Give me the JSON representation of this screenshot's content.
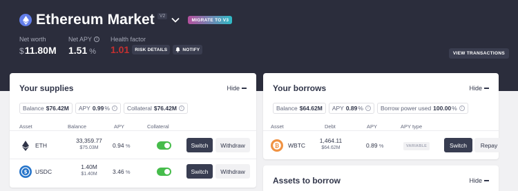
{
  "header": {
    "market_title": "Ethereum Market",
    "version_tag": "V2",
    "migrate_label": "MIGRATE TO V3",
    "net_worth_label": "Net worth",
    "net_worth_symbol": "$",
    "net_worth_value": "11.80M",
    "net_apy_label": "Net APY",
    "net_apy_value": "1.51",
    "net_apy_unit": "%",
    "health_factor_label": "Health factor",
    "health_factor_value": "1.01",
    "risk_details_label": "RISK DETAILS",
    "notify_label": "NOTIFY",
    "view_transactions_label": "VIEW TRANSACTIONS"
  },
  "supplies": {
    "title": "Your supplies",
    "hide_label": "Hide",
    "balance_label": "Balance",
    "balance_value": "$76.42M",
    "apy_label": "APY",
    "apy_value": "0.99",
    "apy_unit": "%",
    "collateral_label": "Collateral",
    "collateral_value": "$76.42M",
    "columns": [
      "Asset",
      "Balance",
      "APY",
      "Collateral"
    ],
    "rows": [
      {
        "asset": "ETH",
        "balance": "33,359.77",
        "balance_usd": "$75.03M",
        "apy": "0.94",
        "apy_unit": "%",
        "collateral_enabled": true,
        "switch_label": "Switch",
        "withdraw_label": "Withdraw"
      },
      {
        "asset": "USDC",
        "balance": "1.40M",
        "balance_usd": "$1.40M",
        "apy": "3.46",
        "apy_unit": "%",
        "collateral_enabled": true,
        "switch_label": "Switch",
        "withdraw_label": "Withdraw"
      }
    ]
  },
  "borrows": {
    "title": "Your borrows",
    "hide_label": "Hide",
    "balance_label": "Balance",
    "balance_value": "$64.62M",
    "apy_label": "APY",
    "apy_value": "0.89",
    "apy_unit": "%",
    "power_label": "Borrow power used",
    "power_value": "100.00",
    "power_unit": "%",
    "columns": [
      "Asset",
      "Debt",
      "APY",
      "APY type"
    ],
    "rows": [
      {
        "asset": "WBTC",
        "debt": "1,464.11",
        "debt_usd": "$64.62M",
        "apy": "0.89",
        "apy_unit": "%",
        "apy_type": "VARIABLE",
        "switch_label": "Switch",
        "repay_label": "Repay"
      }
    ]
  },
  "assets_to_borrow": {
    "title": "Assets to borrow",
    "hide_label": "Hide"
  },
  "colors": {
    "topbar": "#2b2d3c",
    "eth": "#627eea",
    "usdc": "#2775ca",
    "wbtc": "#f09242",
    "toggle_on": "#46bc4b",
    "health_factor": "#c53030"
  },
  "icons": [
    "ethereum-logo",
    "chevron-down-icon",
    "info-icon",
    "bell-icon",
    "eth-icon",
    "usdc-icon",
    "wbtc-icon"
  ]
}
